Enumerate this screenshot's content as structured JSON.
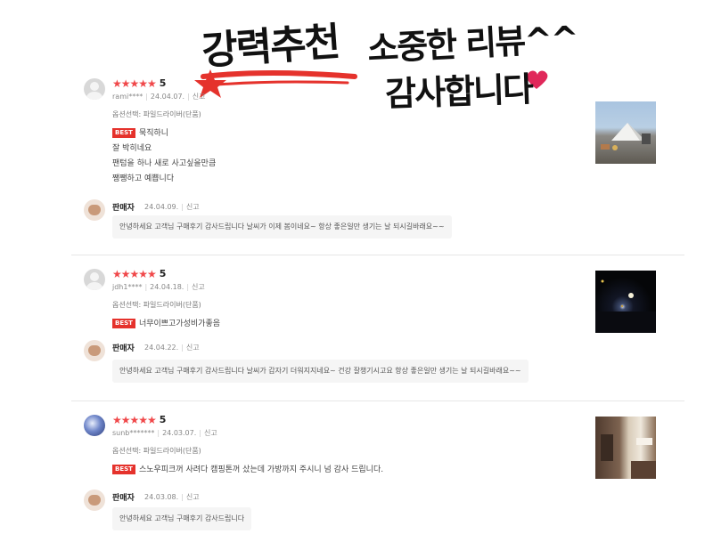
{
  "banner": {
    "line1": "강력추천",
    "line2": "소중한 리뷰^^",
    "line3": "감사합니다"
  },
  "reviews": [
    {
      "stars": "★★★★★",
      "score": "5",
      "user": "rami****",
      "date": "24.04.07.",
      "report": "신고",
      "option": "옵션선택: 파일드라이버(단품)",
      "best": "BEST",
      "lines": [
        "묵직하니",
        "잘 박히네요",
        "팬텀을 하나 새로 사고싶을만큼",
        "쨍쨍하고 예쁩니다"
      ],
      "seller": {
        "name": "판매자",
        "date": "24.04.09.",
        "report": "신고",
        "reply": "안녕하세요 고객님 구매후기 감사드립니다 날씨가 이제 봄이네요~ 항상 좋은일만 생기는 날 되시길바래요~~"
      }
    },
    {
      "stars": "★★★★★",
      "score": "5",
      "user": "jdh1****",
      "date": "24.04.18.",
      "report": "신고",
      "option": "옵션선택: 파일드라이버(단품)",
      "best": "BEST",
      "lines": [
        "너무이쁘고가성비가좋음"
      ],
      "seller": {
        "name": "판매자",
        "date": "24.04.22.",
        "report": "신고",
        "reply": "안녕하세요 고객님 구매후기 감사드립니다 날씨가 갑자기 더워지지네요~ 건강 잘챙기시고요  항상 좋은일만 생기는 날 되시길바래요~~"
      }
    },
    {
      "stars": "★★★★★",
      "score": "5",
      "user": "sunb*******",
      "date": "24.03.07.",
      "report": "신고",
      "option": "옵션선택: 파일드라이버(단품)",
      "best": "BEST",
      "lines": [
        "스노우피크꺼 사려다 캠핑톤꺼 샀는데 가방까지 주시니 넘 감사 드립니다."
      ],
      "seller": {
        "name": "판매자",
        "date": "24.03.08.",
        "report": "신고",
        "reply": "안녕하세요 고객님 구매후기 감사드립니다"
      }
    }
  ],
  "colors": {
    "star": "#f0484a",
    "best_badge": "#e5322c",
    "banner_accent": "#e5322c"
  },
  "icons": {
    "user_avatar": "default-user-icon",
    "seller_avatar": "seller-profile-icon",
    "banner_star": "star-icon",
    "banner_heart": "heart-icon"
  }
}
